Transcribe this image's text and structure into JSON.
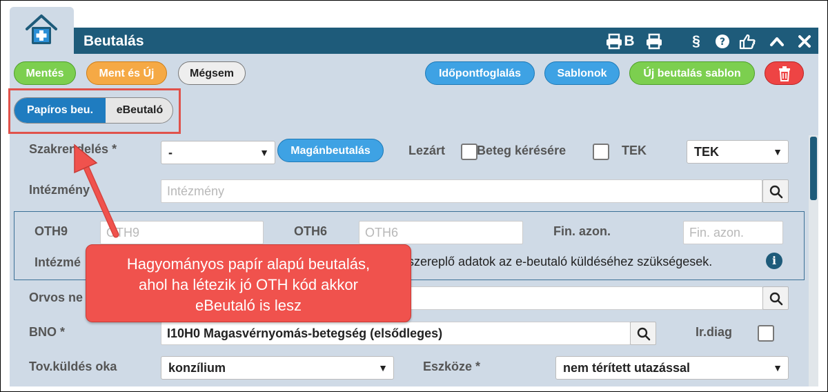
{
  "window": {
    "title": "Beutalás",
    "titlebar_icons": [
      "print-b-icon",
      "b-icon",
      "print-icon",
      "paragraph-icon",
      "help-icon",
      "thumb-icon",
      "collapse-icon",
      "close-icon"
    ],
    "titlebar_text": {
      "b": "B",
      "paragraph": "§"
    }
  },
  "toolbar": {
    "save_label": "Mentés",
    "save_new_label": "Ment és Új",
    "cancel_label": "Mégsem",
    "appointment_label": "Időpontfoglalás",
    "templates_label": "Sablonok",
    "new_template_label": "Új beutalás sablon"
  },
  "referral_type": {
    "paper_label": "Papíros beu.",
    "ereferral_label": "eBeutaló",
    "selected": "paper"
  },
  "form": {
    "szakrendeles_label": "Szakrendelés *",
    "szakrendeles_value": "-",
    "private_referral_label": "Magánbeutalás",
    "lezart_label": "Lezárt",
    "patient_request_label": "Beteg kérésére",
    "tek_label": "TEK",
    "tek_value": "TEK",
    "institution_label": "Intézmény",
    "institution_placeholder": "Intézmény",
    "oth9_label": "OTH9",
    "oth9_placeholder": "OTH9",
    "oth6_label": "OTH6",
    "oth6_placeholder": "OTH6",
    "fin_label": "Fin. azon.",
    "fin_placeholder": "Fin. azon.",
    "institution2_label": "Intézmé",
    "ebeutalo_note": "en szereplő adatok az e-beutaló küldéséhez szükségesek.",
    "doctor_label": "Orvos ne",
    "bno_label": "BNO *",
    "bno_value": "I10H0 Magasvérnyomás-betegség (elsődleges)",
    "irdiag_label": "Ir.diag",
    "forward_reason_label": "Tov.küldés oka",
    "forward_reason_value": "konzílium",
    "means_label": "Eszköze *",
    "means_value": "nem térített utazással"
  },
  "callout": {
    "line1": "Hagyományos papír alapú beutalás,",
    "line2": "ahol ha létezik jó OTH kód akkor",
    "line3": "eBeutaló is lesz"
  },
  "colors": {
    "titlebar": "#1e5b7a",
    "panel": "#cfdae6",
    "callout": "#f0524d",
    "highlight_outline": "#e0524b"
  }
}
